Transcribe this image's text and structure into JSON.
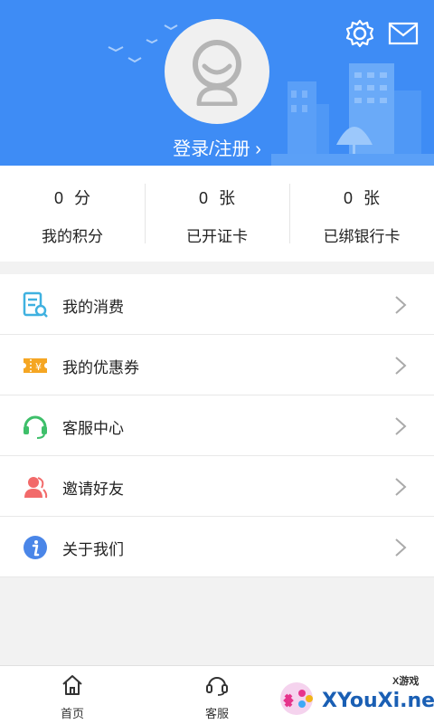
{
  "header": {
    "login_label": "登录/注册",
    "login_chevron": "›",
    "avatar_icon": "default-avatar-icon",
    "settings_icon": "gear-icon",
    "mail_icon": "mail-icon",
    "background_color": "#3e8cf5"
  },
  "stats": [
    {
      "value": "0",
      "unit": "分",
      "label": "我的积分"
    },
    {
      "value": "0",
      "unit": "张",
      "label": "已开证卡"
    },
    {
      "value": "0",
      "unit": "张",
      "label": "已绑银行卡"
    }
  ],
  "menu": [
    {
      "label": "我的消费",
      "icon": "receipt-search-icon"
    },
    {
      "label": "我的优惠券",
      "icon": "coupon-icon"
    },
    {
      "label": "客服中心",
      "icon": "headset-icon"
    },
    {
      "label": "邀请好友",
      "icon": "invite-friend-icon"
    },
    {
      "label": "关于我们",
      "icon": "info-icon"
    }
  ],
  "bottom_nav": [
    {
      "label": "首页",
      "icon": "home-icon"
    },
    {
      "label": "客服",
      "icon": "headset-icon"
    }
  ],
  "watermark": {
    "text": "XYouXi.net",
    "sub": "X游戏"
  }
}
